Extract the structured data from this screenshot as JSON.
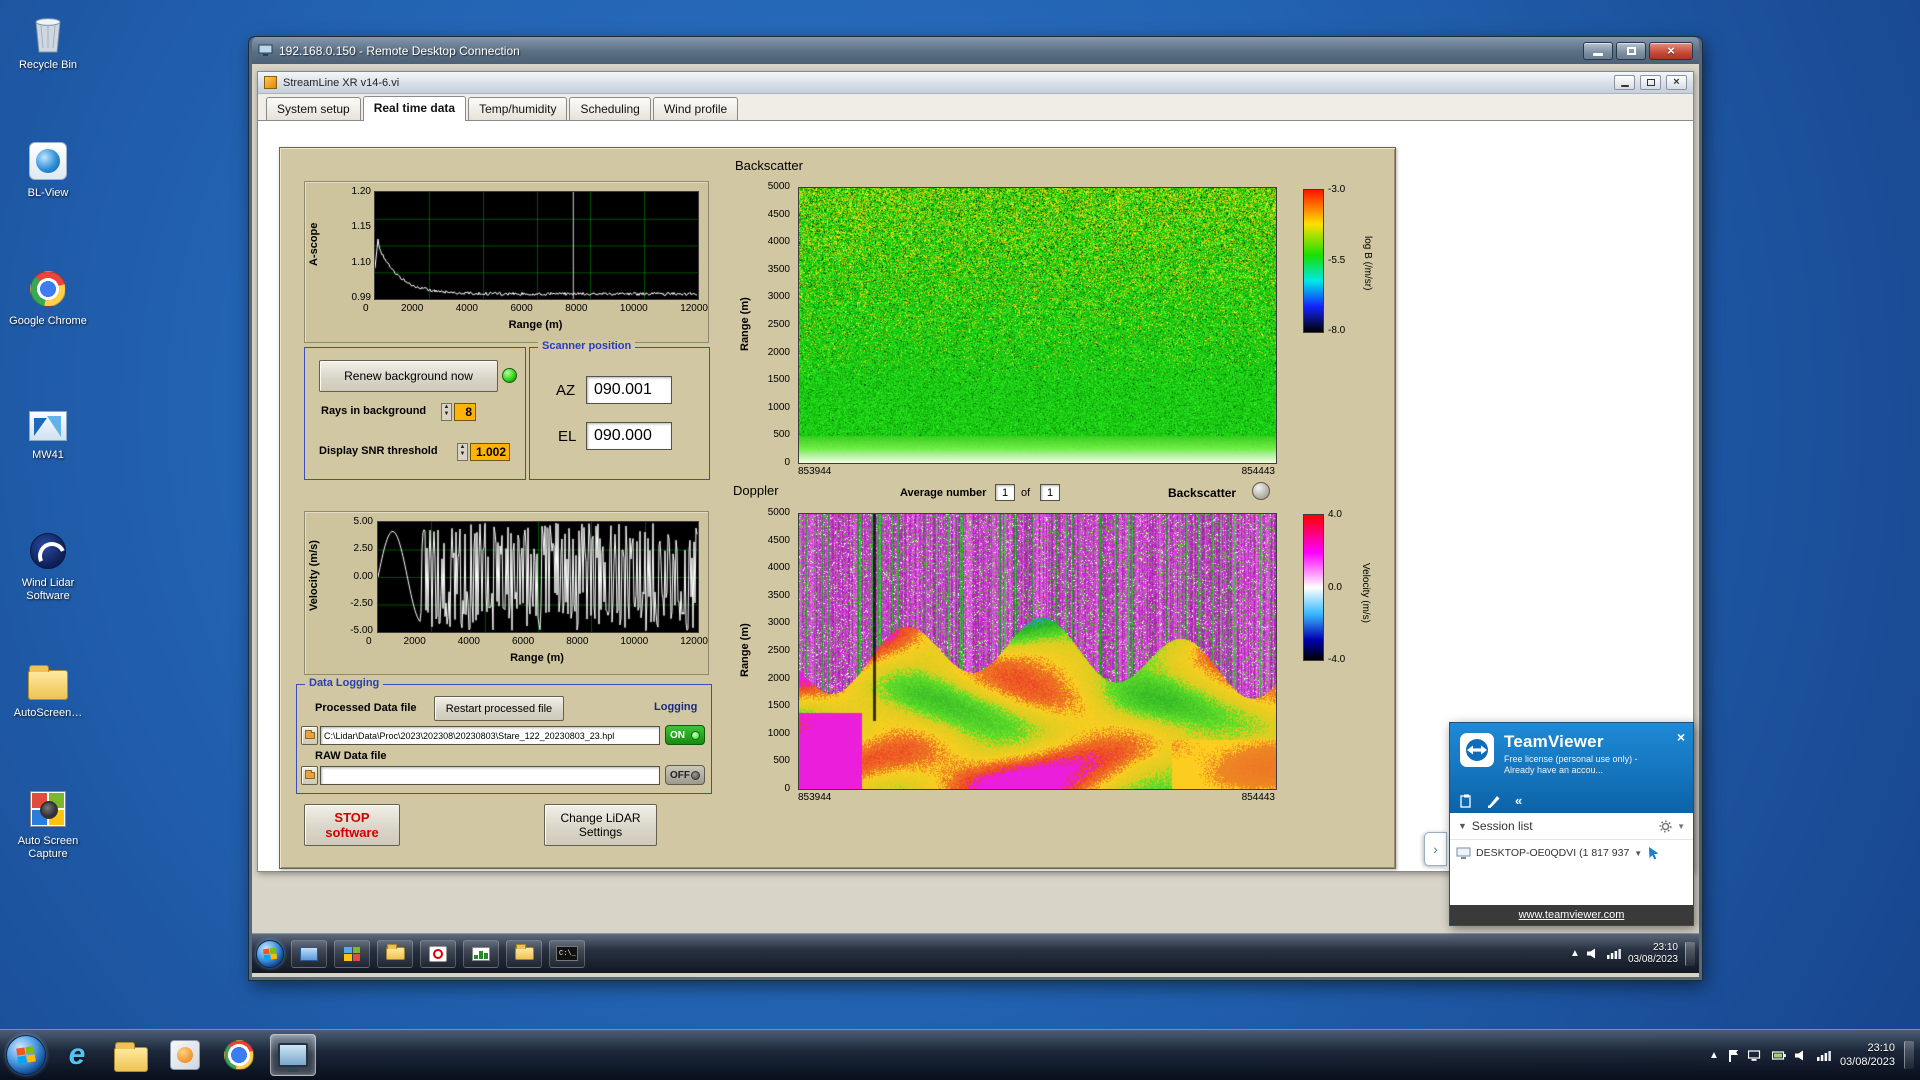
{
  "desktop": {
    "icons": [
      {
        "label": "Recycle Bin"
      },
      {
        "label": "BL-View"
      },
      {
        "label": "Google Chrome"
      },
      {
        "label": "MW41"
      },
      {
        "label": "Wind Lidar Software"
      },
      {
        "label": "AutoScreen…"
      },
      {
        "label": "Auto Screen Capture"
      }
    ]
  },
  "rdp": {
    "title": "192.168.0.150 - Remote Desktop Connection"
  },
  "app": {
    "title": "StreamLine XR v14-6.vi",
    "tabs": [
      {
        "label": "System setup"
      },
      {
        "label": "Real time data"
      },
      {
        "label": "Temp/humidity"
      },
      {
        "label": "Scheduling"
      },
      {
        "label": "Wind profile"
      }
    ],
    "ascope": {
      "ylabel": "A-scope",
      "xlabel": "Range (m)",
      "yticks": [
        "1.20",
        "1.15",
        "1.10",
        "0.99"
      ],
      "xticks": [
        "0",
        "2000",
        "4000",
        "6000",
        "8000",
        "10000",
        "12000"
      ]
    },
    "controls": {
      "renew": "Renew background now",
      "rays_label": "Rays in background",
      "rays_value": "8",
      "snr_label": "Display SNR threshold",
      "snr_value": "1.002"
    },
    "scanner": {
      "title": "Scanner position",
      "az_label": "AZ",
      "az_value": "090.001",
      "el_label": "EL",
      "el_value": "090.000"
    },
    "backscatter": {
      "title": "Backscatter",
      "ylabel": "Range (m)",
      "yticks": [
        "5000",
        "4500",
        "4000",
        "3500",
        "3000",
        "2500",
        "2000",
        "1500",
        "1000",
        "500",
        "0"
      ],
      "x_left": "853944",
      "x_right": "854443",
      "cbar_ticks": [
        "-3.0",
        "-5.5",
        "-8.0"
      ],
      "cbar_label": "log B (/m/sr)"
    },
    "doppler": {
      "title": "Doppler",
      "avg_label": "Average number",
      "avg_value": "1",
      "of_label": "of",
      "of_value": "1",
      "toggle_label": "Backscatter",
      "ylabel": "Range (m)",
      "yticks": [
        "5000",
        "4500",
        "4000",
        "3500",
        "3000",
        "2500",
        "2000",
        "1500",
        "1000",
        "500",
        "0"
      ],
      "x_left": "853944",
      "x_right": "854443",
      "cbar_ticks": [
        "4.0",
        "0.0",
        "-4.0"
      ],
      "cbar_label": "Velocity (m/s)"
    },
    "velocity": {
      "ylabel": "Velocity (m/s)",
      "xlabel": "Range (m)",
      "yticks": [
        "5.00",
        "2.50",
        "0.00",
        "-2.50",
        "-5.00"
      ],
      "xticks": [
        "0",
        "2000",
        "4000",
        "6000",
        "8000",
        "10000",
        "12000"
      ]
    },
    "logging": {
      "title": "Data Logging",
      "processed_label": "Processed Data file",
      "restart": "Restart processed file",
      "logging_label": "Logging",
      "processed_path": "C:\\Lidar\\Data\\Proc\\2023\\202308\\20230803\\Stare_122_20230803_23.hpl",
      "on": "ON",
      "raw_label": "RAW Data file",
      "raw_path": "",
      "off": "OFF"
    },
    "stop_line1": "STOP",
    "stop_line2": "software",
    "change_line1": "Change LiDAR",
    "change_line2": "Settings"
  },
  "remote_taskbar": {
    "time": "23:10",
    "date": "03/08/2023",
    "cmd": "C:\\_"
  },
  "teamviewer": {
    "name": "TeamViewer",
    "license": "Free license (personal use only) - Already have an accou...",
    "session_list": "Session list",
    "session": "DESKTOP-OE0QDVI (1 817 937",
    "link": "www.teamviewer.com"
  },
  "taskbar": {
    "time": "23:10",
    "date": "03/08/2023"
  }
}
